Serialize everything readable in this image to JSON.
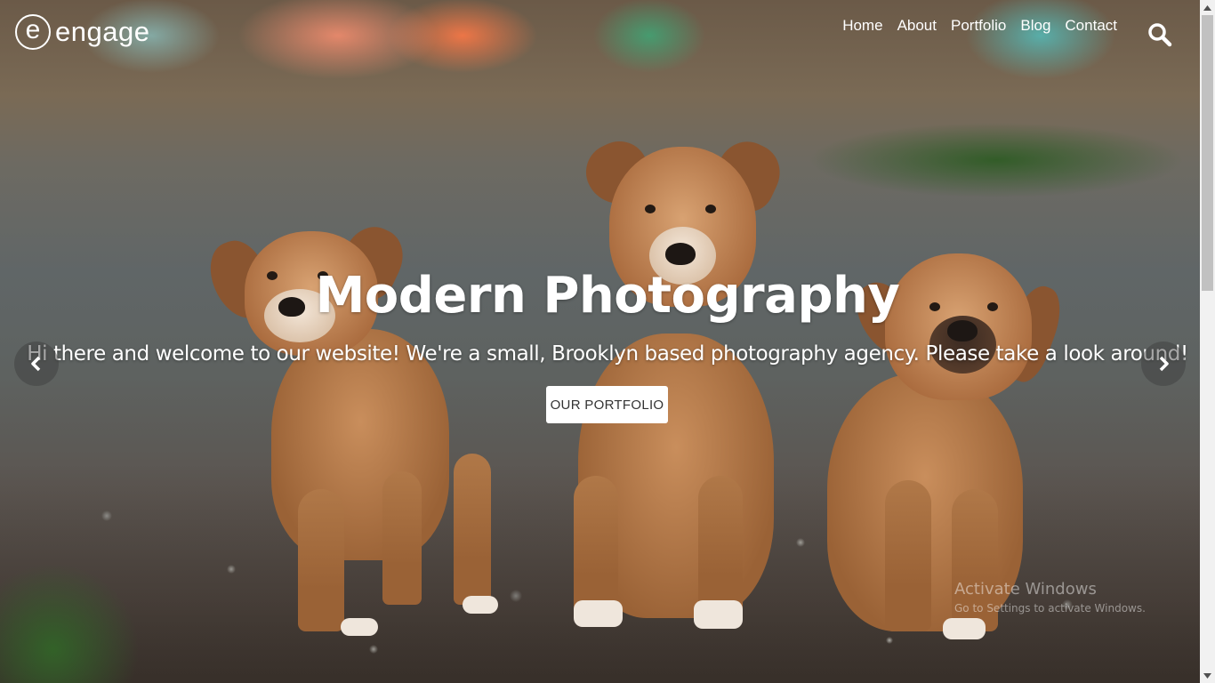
{
  "brand": {
    "logo_letter": "e",
    "name": "engage"
  },
  "nav": {
    "items": [
      {
        "label": "Home"
      },
      {
        "label": "About"
      },
      {
        "label": "Portfolio"
      },
      {
        "label": "Blog"
      },
      {
        "label": "Contact"
      }
    ],
    "search_icon": "search-icon"
  },
  "hero": {
    "title": "Modern Photography",
    "subtitle": "Hi there and welcome to our website! We're a small, Brooklyn based photography agency. Please take a look around!",
    "button_label": "OUR PORTFOLIO",
    "prev_icon": "chevron-left-icon",
    "next_icon": "chevron-right-icon"
  },
  "watermark": {
    "title": "Activate Windows",
    "subtitle": "Go to Settings to activate Windows."
  },
  "colors": {
    "text": "#ffffff",
    "button_bg": "#ffffff",
    "button_text": "#333333"
  }
}
